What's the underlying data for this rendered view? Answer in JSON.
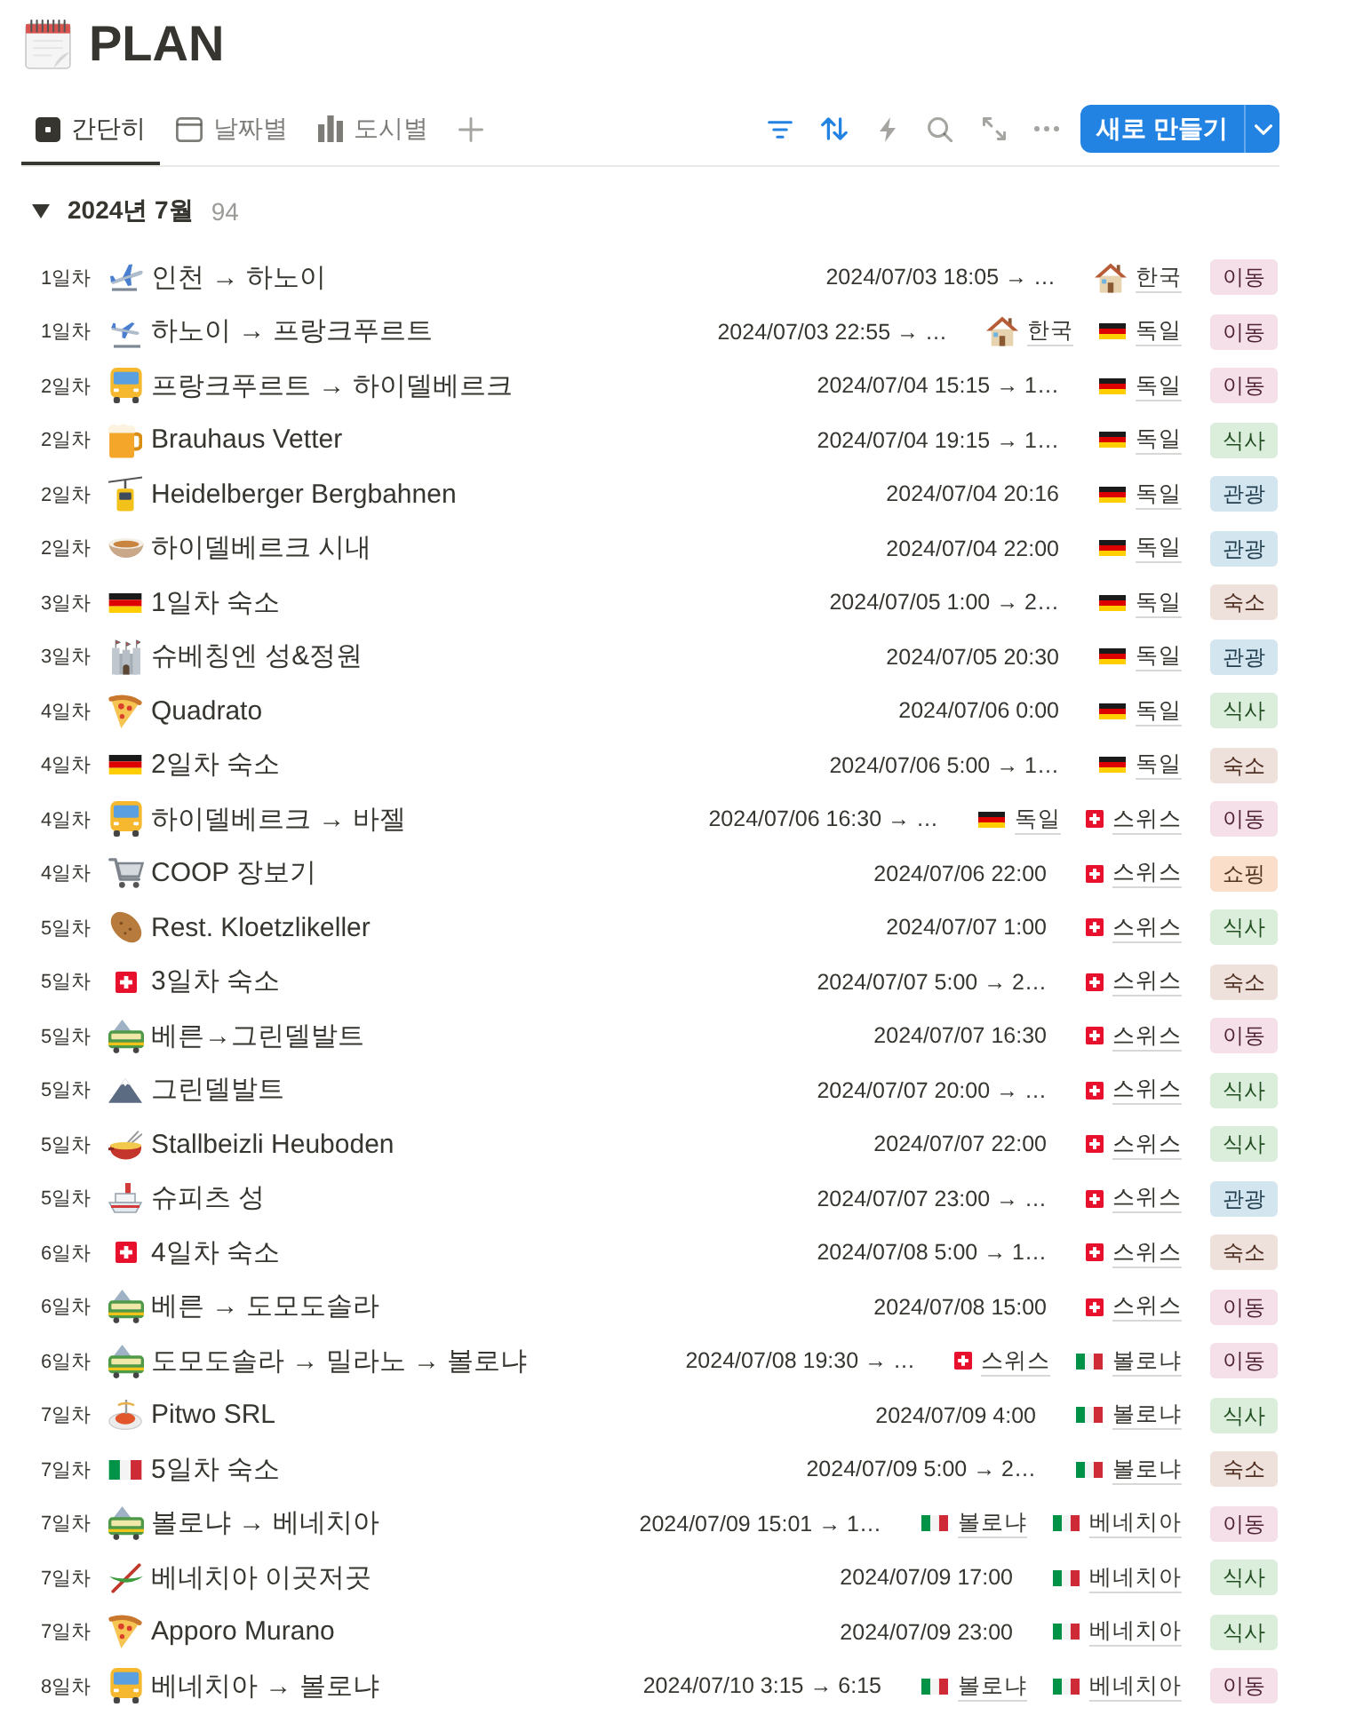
{
  "page": {
    "title": "PLAN"
  },
  "tabs": [
    {
      "label": "간단히",
      "kind": "list",
      "selected": true
    },
    {
      "label": "날짜별",
      "kind": "calendar",
      "selected": false
    },
    {
      "label": "도시별",
      "kind": "chart",
      "selected": false
    }
  ],
  "toolbar": [
    {
      "kind": "filter",
      "active": true
    },
    {
      "kind": "sort",
      "active": true
    },
    {
      "kind": "automation",
      "active": false
    },
    {
      "kind": "search",
      "active": false
    },
    {
      "kind": "expand",
      "active": false
    },
    {
      "kind": "more",
      "active": false
    }
  ],
  "new_button": {
    "label": "새로 만들기"
  },
  "group": {
    "title": "2024년 7월",
    "count": "94",
    "expanded": true,
    "rows": [
      {
        "day": "1일차",
        "kind": "airplane",
        "title": "인천 → 하노이",
        "date": "2024/07/03 18:05 → …",
        "places": [
          {
            "kind": "house",
            "name": "한국"
          }
        ],
        "tag": {
          "label": "이동",
          "color": "#f5e0e9"
        }
      },
      {
        "day": "1일차",
        "kind": "airplane-landing",
        "title": "하노이 → 프랑크푸르트",
        "date": "2024/07/03 22:55 → …",
        "places": [
          {
            "kind": "house",
            "name": "한국"
          },
          {
            "kind": "flag-de",
            "name": "독일"
          }
        ],
        "tag": {
          "label": "이동",
          "color": "#f5e0e9"
        }
      },
      {
        "day": "2일차",
        "kind": "bus",
        "title": "프랑크푸르트 → 하이델베르크",
        "date": "2024/07/04 15:15 → 1…",
        "places": [
          {
            "kind": "flag-de",
            "name": "독일"
          }
        ],
        "tag": {
          "label": "이동",
          "color": "#f5e0e9"
        }
      },
      {
        "day": "2일차",
        "kind": "beer",
        "title": "Brauhaus Vetter",
        "date": "2024/07/04 19:15 → 1…",
        "places": [
          {
            "kind": "flag-de",
            "name": "독일"
          }
        ],
        "tag": {
          "label": "식사",
          "color": "#dbeddb"
        }
      },
      {
        "day": "2일차",
        "kind": "cable-car",
        "title": "Heidelberger Bergbahnen",
        "date": "2024/07/04 20:16",
        "places": [
          {
            "kind": "flag-de",
            "name": "독일"
          }
        ],
        "tag": {
          "label": "관광",
          "color": "#d3e5ef"
        }
      },
      {
        "day": "2일차",
        "kind": "bowl",
        "title": "하이델베르크 시내",
        "date": "2024/07/04 22:00",
        "places": [
          {
            "kind": "flag-de",
            "name": "독일"
          }
        ],
        "tag": {
          "label": "관광",
          "color": "#d3e5ef"
        }
      },
      {
        "day": "3일차",
        "kind": "flag-de",
        "title": "1일차 숙소",
        "date": "2024/07/05 1:00 → 2…",
        "places": [
          {
            "kind": "flag-de",
            "name": "독일"
          }
        ],
        "tag": {
          "label": "숙소",
          "color": "#eee0da"
        }
      },
      {
        "day": "3일차",
        "kind": "castle",
        "title": "슈베칭엔 성&정원",
        "date": "2024/07/05 20:30",
        "places": [
          {
            "kind": "flag-de",
            "name": "독일"
          }
        ],
        "tag": {
          "label": "관광",
          "color": "#d3e5ef"
        }
      },
      {
        "day": "4일차",
        "kind": "pizza",
        "title": "Quadrato",
        "date": "2024/07/06 0:00",
        "places": [
          {
            "kind": "flag-de",
            "name": "독일"
          }
        ],
        "tag": {
          "label": "식사",
          "color": "#dbeddb"
        }
      },
      {
        "day": "4일차",
        "kind": "flag-de",
        "title": "2일차 숙소",
        "date": "2024/07/06 5:00 → 1…",
        "places": [
          {
            "kind": "flag-de",
            "name": "독일"
          }
        ],
        "tag": {
          "label": "숙소",
          "color": "#eee0da"
        }
      },
      {
        "day": "4일차",
        "kind": "bus",
        "title": "하이델베르크 → 바젤",
        "date": "2024/07/06 16:30 → …",
        "places": [
          {
            "kind": "flag-de",
            "name": "독일"
          },
          {
            "kind": "flag-ch",
            "name": "스위스"
          }
        ],
        "tag": {
          "label": "이동",
          "color": "#f5e0e9"
        }
      },
      {
        "day": "4일차",
        "kind": "cart",
        "title": "COOP 장보기",
        "date": "2024/07/06 22:00",
        "places": [
          {
            "kind": "flag-ch",
            "name": "스위스"
          }
        ],
        "tag": {
          "label": "쇼핑",
          "color": "#fadec9"
        }
      },
      {
        "day": "5일차",
        "kind": "potato",
        "title": "Rest. Kloetzlikeller",
        "date": "2024/07/07 1:00",
        "places": [
          {
            "kind": "flag-ch",
            "name": "스위스"
          }
        ],
        "tag": {
          "label": "식사",
          "color": "#dbeddb"
        }
      },
      {
        "day": "5일차",
        "kind": "flag-ch",
        "title": "3일차 숙소",
        "date": "2024/07/07 5:00 → 2…",
        "places": [
          {
            "kind": "flag-ch",
            "name": "스위스"
          }
        ],
        "tag": {
          "label": "숙소",
          "color": "#eee0da"
        }
      },
      {
        "day": "5일차",
        "kind": "train",
        "title": "베른→그린델발트",
        "date": "2024/07/07 16:30",
        "places": [
          {
            "kind": "flag-ch",
            "name": "스위스"
          }
        ],
        "tag": {
          "label": "이동",
          "color": "#f5e0e9"
        }
      },
      {
        "day": "5일차",
        "kind": "mountain",
        "title": "그린델발트",
        "date": "2024/07/07 20:00 → …",
        "places": [
          {
            "kind": "flag-ch",
            "name": "스위스"
          }
        ],
        "tag": {
          "label": "식사",
          "color": "#dbeddb"
        }
      },
      {
        "day": "5일차",
        "kind": "fondue",
        "title": "Stallbeizli Heuboden",
        "date": "2024/07/07 22:00",
        "places": [
          {
            "kind": "flag-ch",
            "name": "스위스"
          }
        ],
        "tag": {
          "label": "식사",
          "color": "#dbeddb"
        }
      },
      {
        "day": "5일차",
        "kind": "ship",
        "title": "슈피츠 성",
        "date": "2024/07/07 23:00 → …",
        "places": [
          {
            "kind": "flag-ch",
            "name": "스위스"
          }
        ],
        "tag": {
          "label": "관광",
          "color": "#d3e5ef"
        }
      },
      {
        "day": "6일차",
        "kind": "flag-ch",
        "title": "4일차 숙소",
        "date": "2024/07/08 5:00 → 1…",
        "places": [
          {
            "kind": "flag-ch",
            "name": "스위스"
          }
        ],
        "tag": {
          "label": "숙소",
          "color": "#eee0da"
        }
      },
      {
        "day": "6일차",
        "kind": "train",
        "title": "베른 → 도모도솔라",
        "date": "2024/07/08 15:00",
        "places": [
          {
            "kind": "flag-ch",
            "name": "스위스"
          }
        ],
        "tag": {
          "label": "이동",
          "color": "#f5e0e9"
        }
      },
      {
        "day": "6일차",
        "kind": "train",
        "title": "도모도솔라 → 밀라노 → 볼로냐",
        "date": "2024/07/08 19:30 → …",
        "places": [
          {
            "kind": "flag-ch",
            "name": "스위스"
          },
          {
            "kind": "flag-it",
            "name": "볼로냐"
          }
        ],
        "tag": {
          "label": "이동",
          "color": "#f5e0e9"
        }
      },
      {
        "day": "7일차",
        "kind": "spaghetti",
        "title": "Pitwo SRL",
        "date": "2024/07/09 4:00",
        "places": [
          {
            "kind": "flag-it",
            "name": "볼로냐"
          }
        ],
        "tag": {
          "label": "식사",
          "color": "#dbeddb"
        }
      },
      {
        "day": "7일차",
        "kind": "flag-it",
        "title": "5일차 숙소",
        "date": "2024/07/09 5:00 → 2…",
        "places": [
          {
            "kind": "flag-it",
            "name": "볼로냐"
          }
        ],
        "tag": {
          "label": "숙소",
          "color": "#eee0da"
        }
      },
      {
        "day": "7일차",
        "kind": "train",
        "title": "볼로냐 → 베네치아",
        "date": "2024/07/09 15:01 → 1…",
        "places": [
          {
            "kind": "flag-it",
            "name": "볼로냐"
          },
          {
            "kind": "flag-it",
            "name": "베네치아"
          }
        ],
        "tag": {
          "label": "이동",
          "color": "#f5e0e9"
        }
      },
      {
        "day": "7일차",
        "kind": "canoe",
        "title": "베네치아 이곳저곳",
        "date": "2024/07/09 17:00",
        "places": [
          {
            "kind": "flag-it",
            "name": "베네치아"
          }
        ],
        "tag": {
          "label": "식사",
          "color": "#dbeddb"
        }
      },
      {
        "day": "7일차",
        "kind": "pizza",
        "title": "Apporo Murano",
        "date": "2024/07/09 23:00",
        "places": [
          {
            "kind": "flag-it",
            "name": "베네치아"
          }
        ],
        "tag": {
          "label": "식사",
          "color": "#dbeddb"
        }
      },
      {
        "day": "8일차",
        "kind": "bus",
        "title": "베네치아 → 볼로냐",
        "date": "2024/07/10 3:15 → 6:15",
        "places": [
          {
            "kind": "flag-it",
            "name": "볼로냐"
          },
          {
            "kind": "flag-it",
            "name": "베네치아"
          }
        ],
        "tag": {
          "label": "이동",
          "color": "#f5e0e9"
        }
      }
    ]
  }
}
